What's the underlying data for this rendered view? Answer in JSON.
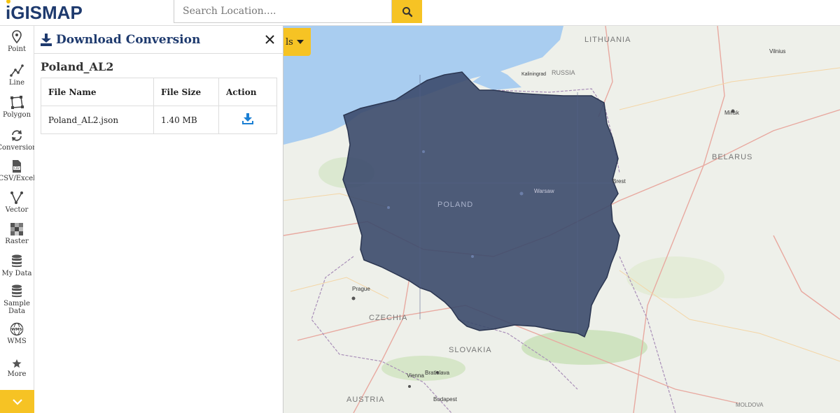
{
  "app": {
    "logo_text": "GISMAP",
    "logo_first_letter": "i",
    "search_placeholder": "Search Location...."
  },
  "sidebar": {
    "items": [
      {
        "label": "Point",
        "icon": "map-pin-icon"
      },
      {
        "label": "Line",
        "icon": "line-icon"
      },
      {
        "label": "Polygon",
        "icon": "polygon-icon"
      },
      {
        "label": "Conversion",
        "icon": "conversion-icon"
      },
      {
        "label": "CSV/Excel",
        "icon": "csv-icon"
      },
      {
        "label": "Vector",
        "icon": "vector-icon"
      },
      {
        "label": "Raster",
        "icon": "raster-icon"
      },
      {
        "label": "My Data",
        "icon": "database-icon"
      },
      {
        "label": "Sample Data",
        "label_line1": "Sample",
        "label_line2": "Data",
        "icon": "database-icon"
      },
      {
        "label": "WMS",
        "icon": "wms-icon"
      },
      {
        "label": "More",
        "icon": "star-icon"
      }
    ]
  },
  "panel": {
    "title": "Download Conversion",
    "file_heading": "Poland_AL2",
    "table": {
      "headers": [
        "File Name",
        "File Size",
        "Action"
      ],
      "rows": [
        {
          "name": "Poland_AL2.json",
          "size": "1.40 MB",
          "action_icon": "download-icon"
        }
      ]
    }
  },
  "map": {
    "details_button_label": "ls",
    "labels": {
      "poland": "POLAND",
      "lithuania": "LITHUANIA",
      "russia": "RUSSIA",
      "belarus": "BELARUS",
      "czechia": "CZECHIA",
      "slovakia": "SLOVAKIA",
      "austria": "AUSTRIA",
      "moldova": "MOLDOVA",
      "warsaw": "Warsaw",
      "minsk": "Minsk",
      "prague": "Prague",
      "vienna": "Vienna",
      "bratislava": "Bratislava",
      "budapest": "Budapest",
      "kaliningrad": "Kaliningrad",
      "brest": "Brest",
      "vilnius": "Vilnius"
    }
  },
  "colors": {
    "accent": "#f6c324",
    "brand": "#1e3a6e",
    "polygon_fill": "#3b4a6b",
    "download_icon": "#1a7fd4",
    "sea": "#a9cdf0"
  }
}
